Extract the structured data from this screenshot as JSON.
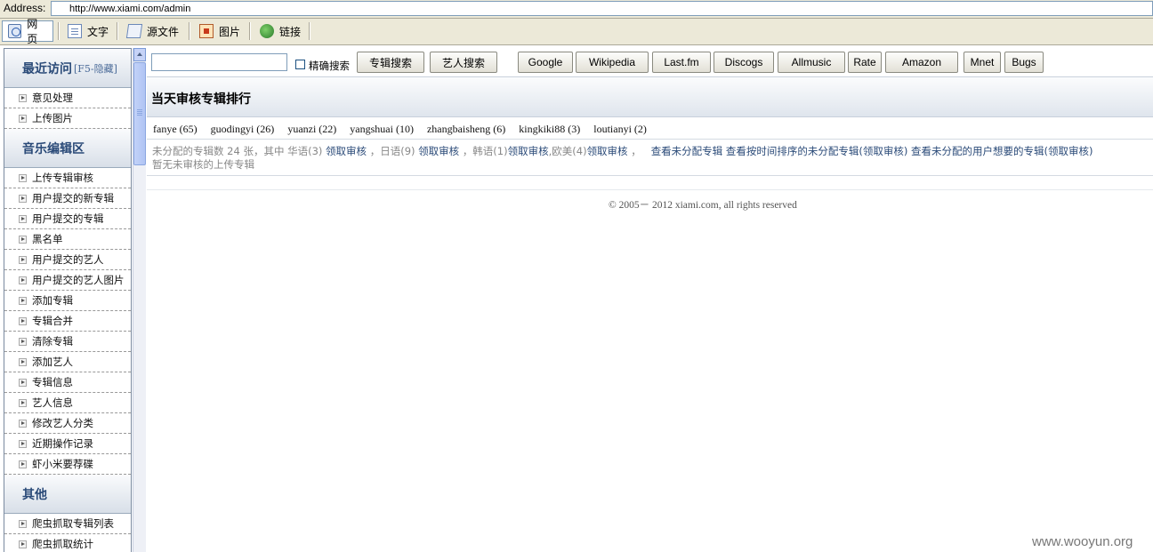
{
  "address_bar": {
    "label": "Address:",
    "url": "http://www.xiami.com/admin"
  },
  "toolbar": {
    "items": [
      {
        "label": "网页",
        "icon": "web-page-icon"
      },
      {
        "label": "文字",
        "icon": "text-document-icon"
      },
      {
        "label": "源文件",
        "icon": "source-file-icon"
      },
      {
        "label": "图片",
        "icon": "image-icon"
      },
      {
        "label": "链接",
        "icon": "link-globe-icon"
      }
    ]
  },
  "sidebar": {
    "recent": {
      "title": "最近访问",
      "hint": "[F5-隐藏]",
      "items": [
        "意见处理",
        "上传图片"
      ]
    },
    "music": {
      "title": "音乐编辑区",
      "items": [
        "上传专辑审核",
        "用户提交的新专辑",
        "用户提交的专辑",
        "黑名单",
        "用户提交的艺人",
        "用户提交的艺人图片",
        "添加专辑",
        "专辑合并",
        "清除专辑",
        "添加艺人",
        "专辑信息",
        "艺人信息",
        "修改艺人分类",
        "近期操作记录",
        "虾小米要荐碟"
      ]
    },
    "other": {
      "title": "其他",
      "items": [
        "爬虫抓取专辑列表",
        "爬虫抓取统计"
      ]
    }
  },
  "search": {
    "input_value": "",
    "exact_label": "精确搜索",
    "album_search": "专辑搜索",
    "artist_search": "艺人搜索",
    "external": [
      "Google",
      "Wikipedia",
      "Last.fm",
      "Discogs",
      "Allmusic",
      "Rate",
      "Amazon",
      "Mnet",
      "Bugs"
    ]
  },
  "main": {
    "title": "当天审核专辑排行",
    "rankings": [
      "fanye (65)",
      "guodingyi (26)",
      "yuanzi (22)",
      "yangshuai (10)",
      "zhangbaisheng (6)",
      "kingkiki88 (3)",
      "loutianyi (2)"
    ],
    "unassigned": {
      "prefix": "未分配的专辑数  24 张，其中  华语(3)",
      "claim": "领取审核",
      "jp": "，日语(9)",
      "kr": "，韩语(1)",
      "west": ",欧美(4)",
      "sep": "，",
      "view_unassigned": "查看未分配专辑",
      "view_by_time_a": "查看按时间排序的未分配专辑(",
      "view_by_time_b": ")",
      "view_user_a": "查看未分配的用户想要的专辑(",
      "view_user_b": ")"
    },
    "no_uploads": "暂无未审核的上传专辑",
    "footer": "© 2005－ 2012 xiami.com, all rights reserved"
  },
  "watermark": "www.wooyun.org"
}
